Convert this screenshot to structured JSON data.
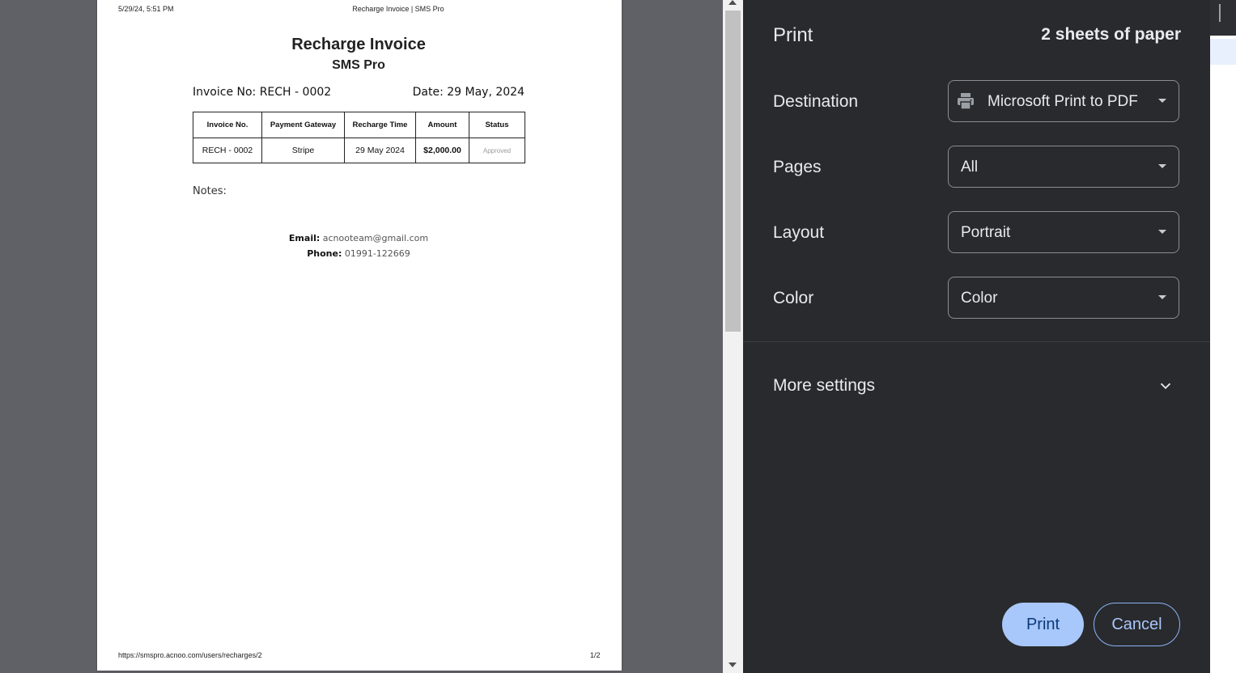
{
  "preview": {
    "print_date": "5/29/24, 5:51 PM",
    "print_title": "Recharge Invoice | SMS Pro",
    "footer_url": "https://smspro.acnoo.com/users/recharges/2",
    "footer_page": "1/2",
    "invoice": {
      "title": "Recharge Invoice",
      "subtitle": "SMS Pro",
      "invoice_no": "Invoice No: RECH - 0002",
      "date": "Date: 29 May, 2024",
      "table": {
        "headers": [
          "Invoice No.",
          "Payment Gateway",
          "Recharge Time",
          "Amount",
          "Status"
        ],
        "row": [
          "RECH - 0002",
          "Stripe",
          "29 May 2024",
          "$2,000.00",
          "Approved"
        ]
      },
      "notes_label": "Notes:",
      "email_label": "Email:",
      "email_value": "acnooteam@gmail.com",
      "phone_label": "Phone:",
      "phone_value": "01991-122669"
    }
  },
  "settings": {
    "title": "Print",
    "sheet_count": "2 sheets of paper",
    "destination": {
      "label": "Destination",
      "value": "Microsoft Print to PDF",
      "icon": "printer-icon"
    },
    "pages": {
      "label": "Pages",
      "value": "All"
    },
    "layout": {
      "label": "Layout",
      "value": "Portrait"
    },
    "color": {
      "label": "Color",
      "value": "Color"
    },
    "more_settings": "More settings",
    "print_label": "Print",
    "cancel_label": "Cancel"
  },
  "colors": {
    "panel_bg": "#292a2d",
    "preview_bg": "#5f6166",
    "primary_button": "#a8c7fa",
    "accent": "#8ab4f8"
  }
}
